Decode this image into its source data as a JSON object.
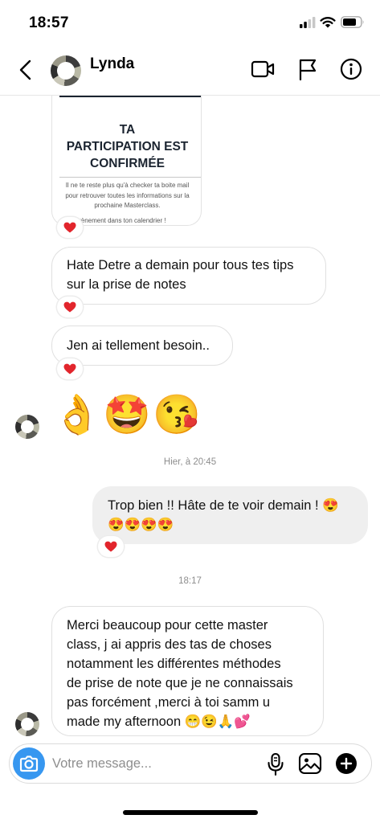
{
  "status_bar": {
    "time": "18:57"
  },
  "header": {
    "contact_name": "Lynda"
  },
  "shared_card": {
    "title": "TA\nPARTICIPATION EST\nCONFIRMÉE",
    "body": "Il ne te reste plus qu'à checker ta boite mail\npour retrouver toutes les informations sur la\nprochaine Masterclass.",
    "footer": "l'évènement dans ton calendrier !"
  },
  "messages": [
    {
      "text": "Hate Detre a demain pour tous tes tips\nsur la prise de notes",
      "reaction": "❤️"
    },
    {
      "text": "Jen ai tellement besoin..",
      "reaction": "❤️"
    },
    {
      "emojis": [
        "👌",
        "🤩",
        "😘"
      ]
    }
  ],
  "timestamp_1": "Hier, à 20:45",
  "outgoing_message": {
    "text": "Trop bien !! Hâte de te voir demain ! 😍\n😍😍😍😍",
    "reaction": "❤️"
  },
  "timestamp_2": "18:17",
  "last_message": {
    "text": "Merci beaucoup pour cette master\nclass, j ai appris des tas de choses\nnotamment les différentes méthodes\nde prise de note que je ne connaissais\npas forcément ,merci à toi samm u\nmade my afternoon 😁😉🙏💕"
  },
  "card_reaction": "❤️",
  "composer": {
    "placeholder": "Votre message..."
  },
  "colors": {
    "accent": "#3797f0",
    "outgoing_bubble": "#efefef",
    "timestamp": "#8e8e8e"
  }
}
